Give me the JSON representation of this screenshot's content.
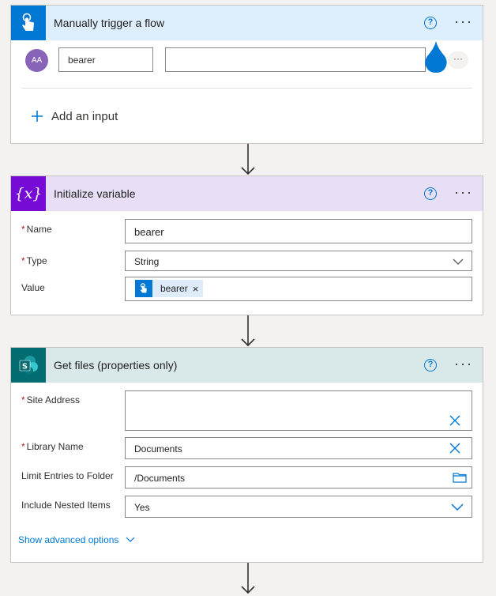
{
  "trigger": {
    "title": "Manually trigger a flow",
    "avatar_text": "AA",
    "input_name": "bearer",
    "input_value": "",
    "add_input_label": "Add an input",
    "help_symbol": "?",
    "more_symbol": "···"
  },
  "init_variable": {
    "title": "Initialize variable",
    "header_symbol": "{x}",
    "help_symbol": "?",
    "more_symbol": "···",
    "name_label": "Name",
    "name_value": "bearer",
    "type_label": "Type",
    "type_value": "String",
    "value_label": "Value",
    "token_label": "bearer",
    "token_remove": "×"
  },
  "get_files": {
    "title": "Get files (properties only)",
    "help_symbol": "?",
    "more_symbol": "···",
    "site_address_label": "Site Address",
    "site_address_value": "",
    "library_name_label": "Library Name",
    "library_name_value": "Documents",
    "limit_folder_label": "Limit Entries to Folder",
    "limit_folder_value": "/Documents",
    "nested_label": "Include Nested Items",
    "nested_value": "Yes",
    "advanced_label": "Show advanced options"
  },
  "required_marker": "*",
  "colors": {
    "trigger_header": "#ddeefc",
    "trigger_icon": "#0078d4",
    "variable_header": "#e8dff6",
    "variable_icon": "#770bd6",
    "sharepoint_header": "#d9e9ea",
    "sharepoint_icon": "#036c70",
    "accent": "#0078d4"
  }
}
